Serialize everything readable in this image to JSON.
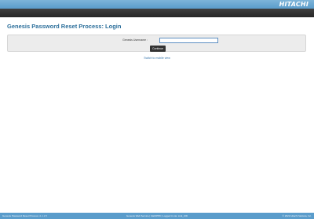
{
  "header": {
    "logo": "HITACHI"
  },
  "page": {
    "title": "Genesis Password Reset Process: Login"
  },
  "form": {
    "username_label": "Genesis Username :",
    "username_value": "",
    "continue_label": "Continue"
  },
  "links": {
    "mobile_view": "Switch to mobile view"
  },
  "footer": {
    "app_name": "Genesis Password Reset Process",
    "version": "v1.1.2.5",
    "center_text": "Genesis Web Service | GENPPD | Logged in via: Link_UID",
    "copyright": "© 2022 Hitachi Vantara, Inc."
  },
  "colors": {
    "top_bar": "#5a9ccb",
    "dark_bar": "#2e2e2e",
    "title": "#2c6f9b",
    "button": "#333333",
    "footer": "#5a9ccb"
  }
}
